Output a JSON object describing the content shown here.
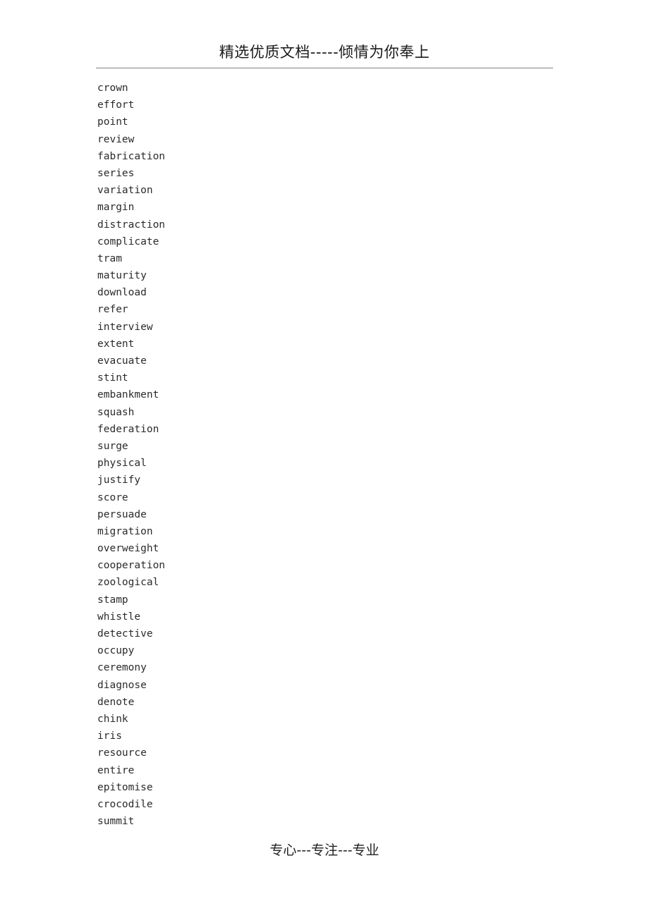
{
  "document": {
    "header": {
      "text": "精选优质文档-----倾情为你奉上",
      "rule_color": "#808080"
    },
    "footer": {
      "text": "专心---专注---专业"
    },
    "body": {
      "text_color": "#2b2b2b",
      "words": [
        "crown",
        "effort",
        "point",
        "review",
        "fabrication",
        "series",
        "variation",
        "margin",
        "distraction",
        "complicate",
        "tram",
        "maturity",
        "download",
        "refer",
        "interview",
        "extent",
        "evacuate",
        "stint",
        "embankment",
        "squash",
        "federation",
        "surge",
        "physical",
        "justify",
        "score",
        "persuade",
        "migration",
        "overweight",
        "cooperation",
        "zoological",
        "stamp",
        "whistle",
        "detective",
        "occupy",
        "ceremony",
        "diagnose",
        "denote",
        "chink",
        "iris",
        "resource",
        "entire",
        "epitomise",
        "crocodile",
        "summit"
      ]
    }
  }
}
